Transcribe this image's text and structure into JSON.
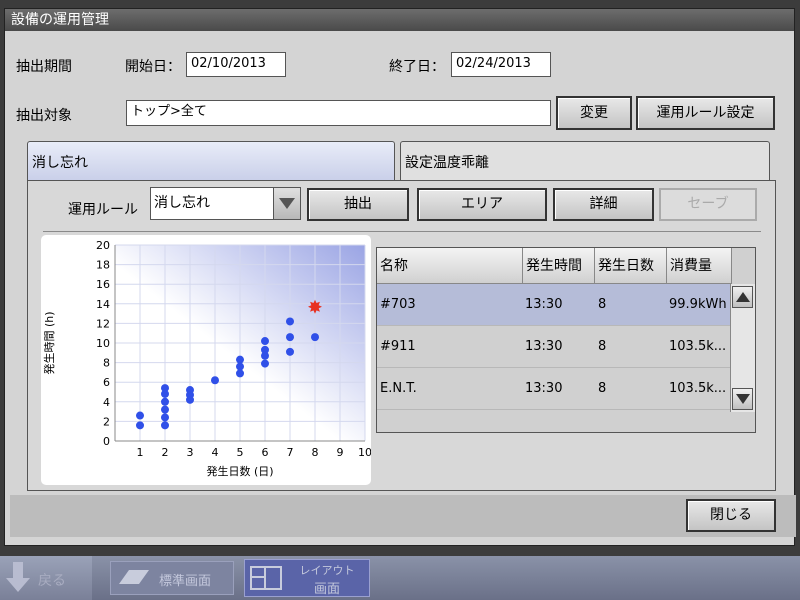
{
  "window": {
    "title": "設備の運用管理"
  },
  "extract": {
    "period_label": "抽出期間",
    "start_label": "開始日：",
    "start_value": "02/10/2013",
    "end_label": "終了日：",
    "end_value": "02/24/2013",
    "target_label": "抽出対象",
    "target_value": "トップ>全て",
    "change_label": "変更",
    "rule_setting_label": "運用ルール設定"
  },
  "tabs": [
    {
      "label": "消し忘れ",
      "active": true
    },
    {
      "label": "設定温度乖離",
      "active": false
    }
  ],
  "panel": {
    "rule_label": "運用ルール",
    "rule_value": "消し忘れ",
    "extract_btn": "抽出",
    "area_btn": "エリア",
    "detail_btn": "詳細",
    "save_btn": "セーブ"
  },
  "chart_data": {
    "type": "scatter",
    "xlabel": "発生日数 (日)",
    "ylabel": "発生時間 (h)",
    "xlim": [
      0,
      10
    ],
    "ylim": [
      0,
      20
    ],
    "xticks": [
      1,
      2,
      3,
      4,
      5,
      6,
      7,
      8,
      9,
      10
    ],
    "yticks": [
      0,
      2,
      4,
      6,
      8,
      10,
      12,
      14,
      16,
      18,
      20
    ],
    "grid": true,
    "points": [
      [
        1,
        1.6
      ],
      [
        1,
        2.6
      ],
      [
        2,
        1.6
      ],
      [
        2,
        2.4
      ],
      [
        2,
        3.2
      ],
      [
        2,
        4.0
      ],
      [
        2,
        4.8
      ],
      [
        2,
        5.4
      ],
      [
        3,
        4.2
      ],
      [
        3,
        4.7
      ],
      [
        3,
        5.2
      ],
      [
        4,
        6.2
      ],
      [
        5,
        6.9
      ],
      [
        5,
        7.6
      ],
      [
        5,
        8.3
      ],
      [
        6,
        7.9
      ],
      [
        6,
        8.7
      ],
      [
        6,
        9.3
      ],
      [
        6,
        10.2
      ],
      [
        7,
        9.1
      ],
      [
        7,
        10.6
      ],
      [
        7,
        12.2
      ],
      [
        8,
        10.6
      ]
    ],
    "highlight": [
      8,
      13.7
    ],
    "point_color": "#3050e8",
    "highlight_color": "#e83020"
  },
  "table": {
    "headers": [
      "名称",
      "発生時間",
      "発生日数",
      "消費量"
    ],
    "rows": [
      [
        "#703",
        "13:30",
        "8",
        "99.9kWh"
      ],
      [
        "#911",
        "13:30",
        "8",
        "103.5k..."
      ],
      [
        "E.N.T.",
        "13:30",
        "8",
        "103.5k..."
      ]
    ],
    "selected_row": 0
  },
  "footer": {
    "close_label": "閉じる"
  },
  "taskbar": {
    "back_label": "戻る",
    "standard_label": "標準画面",
    "layout_label_1": "レイアウト",
    "layout_label_2": "画面"
  }
}
